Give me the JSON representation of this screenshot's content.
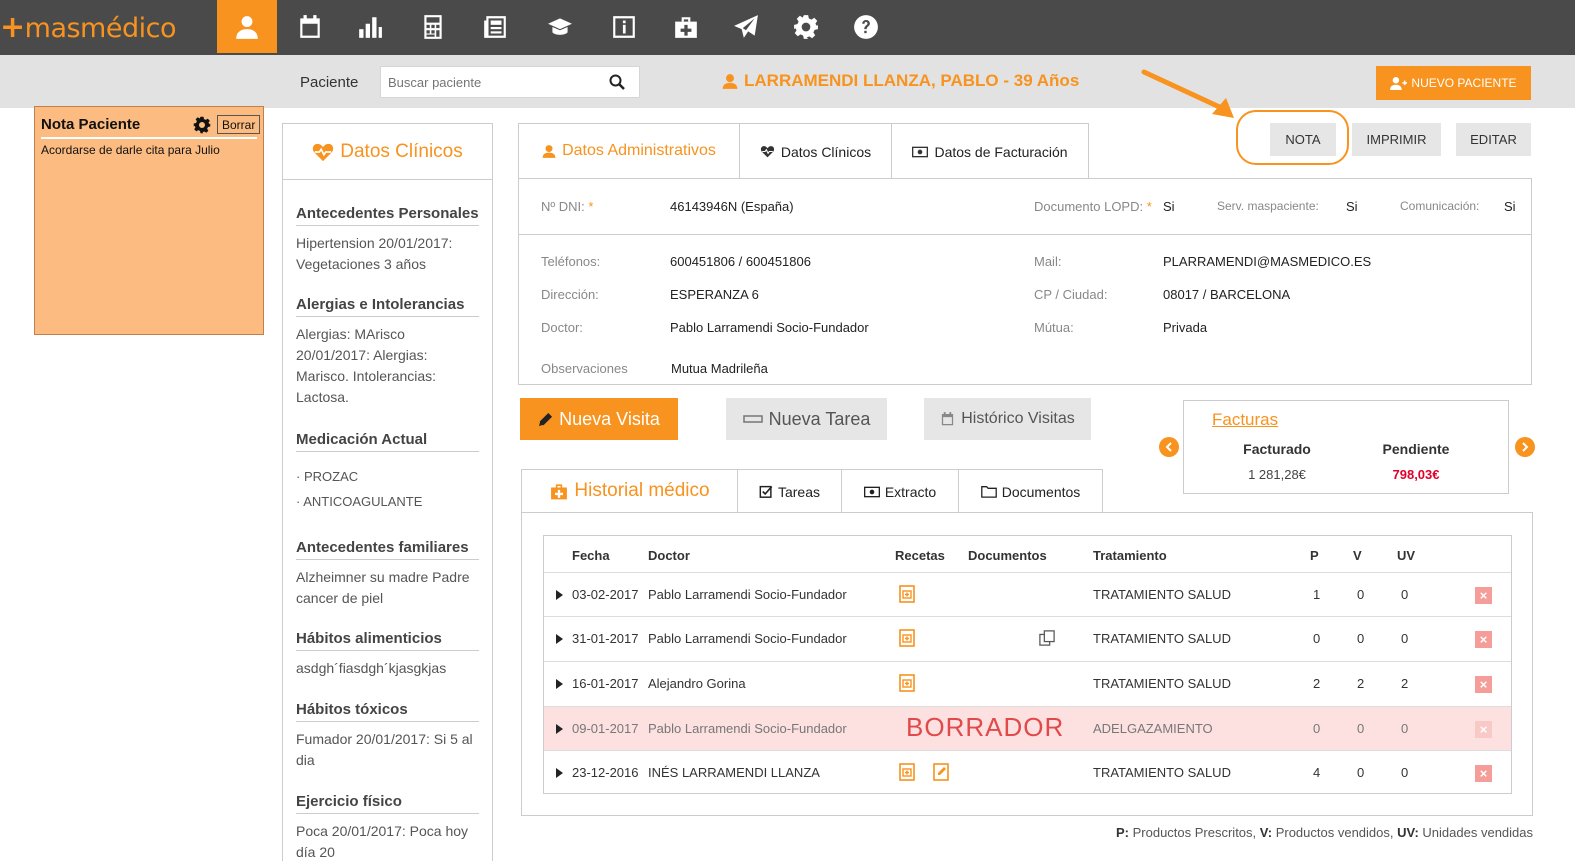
{
  "brand": {
    "logo_plus": "+",
    "logo_text": "masmédico",
    "accent": "#f7931e"
  },
  "nav_icons": [
    "user-icon",
    "calendar-icon",
    "chart-icon",
    "calculator-icon",
    "newspaper-icon",
    "graduation-cap-icon",
    "info-icon",
    "first-aid-kit-icon",
    "paper-plane-icon",
    "gear-icon",
    "help-icon"
  ],
  "search": {
    "label": "Paciente",
    "placeholder": "Buscar paciente"
  },
  "patient": {
    "name": "LARRAMENDI LLANZA, PABLO - 39 Años"
  },
  "header_buttons": {
    "nuevo_paciente": "NUEVO PACIENTE",
    "nota": "NOTA",
    "imprimir": "IMPRIMIR",
    "editar": "EDITAR"
  },
  "nota": {
    "title": "Nota Paciente",
    "borrar": "Borrar",
    "text": "Acordarse de darle cita para Julio"
  },
  "clinicos": {
    "title": "Datos Clínicos",
    "sections": [
      {
        "title": "Antecedentes Personales",
        "text": "Hipertension 20/01/2017: Vegetaciones 3 años"
      },
      {
        "title": "Alergias e Intolerancias",
        "text": "Alergias: MArisco 20/01/2017: Alergias: Marisco. Intolerancias: Lactosa."
      },
      {
        "title": "Medicación Actual",
        "items": [
          "PROZAC",
          "ANTICOAGULANTE"
        ]
      },
      {
        "title": "Antecedentes familiares",
        "text": "Alzheimner su madre Padre cancer de piel"
      },
      {
        "title": "Hábitos alimenticios",
        "text": "asdgh´fiasdgh´kjasgkjas"
      },
      {
        "title": "Hábitos tóxicos",
        "text": "Fumador 20/01/2017: Si 5 al dia"
      },
      {
        "title": "Ejercicio físico",
        "text": "Poca 20/01/2017: Poca hoy día 20"
      }
    ]
  },
  "tabs_main": [
    "Datos Administrativos",
    "Datos Clínicos",
    "Datos de Facturación"
  ],
  "admin": {
    "dni_label": "Nº DNI:",
    "dni": "46143946N (España)",
    "lopd_label": "Documento LOPD:",
    "lopd": "Si",
    "serv_label": "Serv. maspaciente:",
    "serv": "Si",
    "com_label": "Comunicación:",
    "com": "Si",
    "tel_label": "Teléfonos:",
    "tel": "600451806 / 600451806",
    "mail_label": "Mail:",
    "mail": "PLARRAMENDI@MASMEDICO.ES",
    "dir_label": "Dirección:",
    "dir": "ESPERANZA 6",
    "cp_label": "CP / Ciudad:",
    "cp": "08017 / BARCELONA",
    "doctor_label": "Doctor:",
    "doctor": "Pablo Larramendi Socio-Fundador",
    "mutua_label": "Mútua:",
    "mutua": "Privada",
    "obs_label": "Observaciones",
    "obs": "Mutua Madrileña",
    "required_mark": "*"
  },
  "actions": {
    "nueva_visita": "Nueva Visita",
    "nueva_tarea": "Nueva Tarea",
    "historico": "Histórico Visitas"
  },
  "facturas": {
    "title": "Facturas",
    "facturado_label": "Facturado",
    "facturado": "1 281,28€",
    "pendiente_label": "Pendiente",
    "pendiente": "798,03€"
  },
  "tabs_hist": [
    "Historial médico",
    "Tareas",
    "Extracto",
    "Documentos"
  ],
  "table": {
    "headers": {
      "fecha": "Fecha",
      "doctor": "Doctor",
      "recetas": "Recetas",
      "documentos": "Documentos",
      "tratamiento": "Tratamiento",
      "p": "P",
      "v": "V",
      "uv": "UV"
    },
    "rows": [
      {
        "fecha": "03-02-2017",
        "doctor": "Pablo Larramendi Socio-Fundador",
        "tratamiento": "TRATAMIENTO SALUD",
        "p": "1",
        "v": "0",
        "uv": "0"
      },
      {
        "fecha": "31-01-2017",
        "doctor": "Pablo Larramendi Socio-Fundador",
        "tratamiento": "TRATAMIENTO SALUD",
        "p": "0",
        "v": "0",
        "uv": "0"
      },
      {
        "fecha": "16-01-2017",
        "doctor": "Alejandro Gorina",
        "tratamiento": "TRATAMIENTO SALUD",
        "p": "2",
        "v": "2",
        "uv": "2"
      },
      {
        "fecha": "09-01-2017",
        "doctor": "Pablo Larramendi Socio-Fundador",
        "draft_label": "BORRADOR",
        "tratamiento": "ADELGAZAMIENTO",
        "p": "0",
        "v": "0",
        "uv": "0"
      },
      {
        "fecha": "23-12-2016",
        "doctor": "INÉS LARRAMENDI LLANZA",
        "tratamiento": "TRATAMIENTO SALUD",
        "p": "4",
        "v": "0",
        "uv": "0"
      }
    ],
    "delete_glyph": "×"
  },
  "legend": {
    "p_key": "P:",
    "p_text": "Productos Prescritos,",
    "v_key": "V:",
    "v_text": "Productos vendidos,",
    "uv_key": "UV:",
    "uv_text": "Unidades vendidas"
  }
}
